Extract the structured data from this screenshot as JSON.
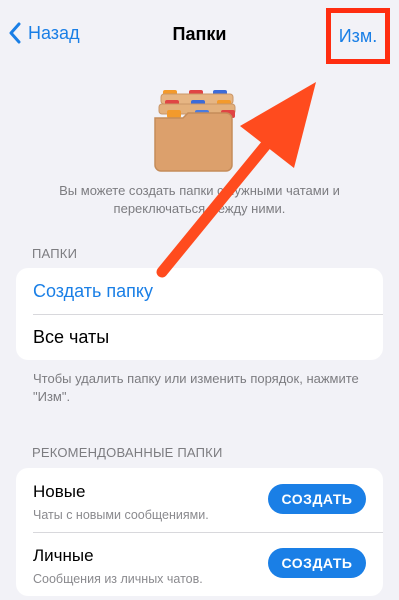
{
  "nav": {
    "back_label": "Назад",
    "title": "Папки",
    "edit_label": "Изм."
  },
  "intro_text": "Вы можете создать папки с нужными чатами и переключаться между ними.",
  "folders_section": {
    "header": "ПАПКИ",
    "create_label": "Создать папку",
    "all_chats_label": "Все чаты",
    "footer": "Чтобы удалить папку или изменить порядок, нажмите \"Изм\"."
  },
  "recommended_section": {
    "header": "РЕКОМЕНДОВАННЫЕ ПАПКИ",
    "items": [
      {
        "title": "Новые",
        "subtitle": "Чаты с новыми сообщениями.",
        "button": "СОЗДАТЬ"
      },
      {
        "title": "Личные",
        "subtitle": "Сообщения из личных чатов.",
        "button": "СОЗДАТЬ"
      }
    ]
  },
  "colors": {
    "accent": "#1a7fe6",
    "annotation": "#ff2d10",
    "background": "#f2f2f7"
  },
  "icons": {
    "back": "chevron-left-icon",
    "illustration": "folders-illustration-icon",
    "annotation_arrow": "arrow-icon"
  }
}
